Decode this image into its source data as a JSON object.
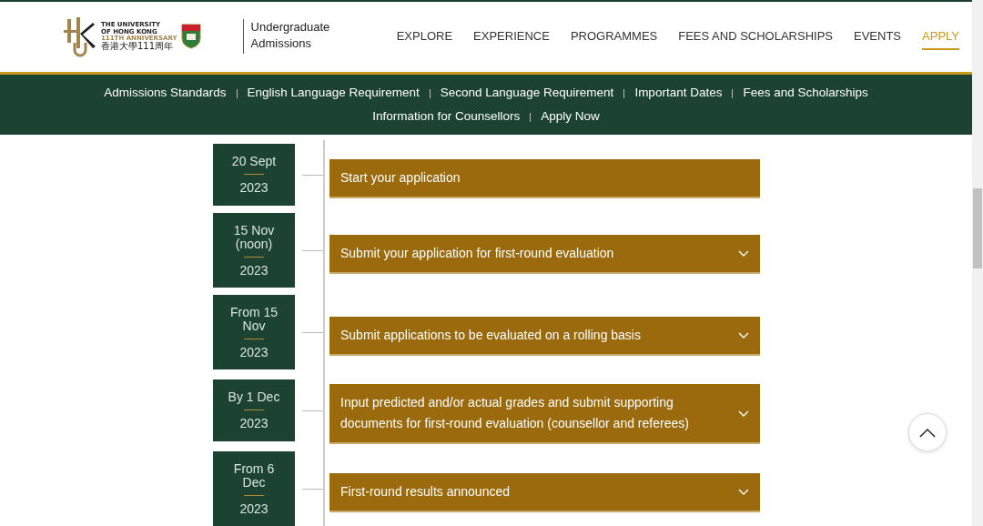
{
  "header": {
    "logo": {
      "lines": [
        "THE UNIVERSITY",
        "OF HONG KONG",
        "111TH ANNIVERSARY",
        "香港大學111周年"
      ]
    },
    "site_title": [
      "Undergraduate",
      "Admissions"
    ],
    "nav": [
      {
        "label": "EXPLORE",
        "selected": false
      },
      {
        "label": "EXPERIENCE",
        "selected": false
      },
      {
        "label": "PROGRAMMES",
        "selected": false
      },
      {
        "label": "FEES AND SCHOLARSHIPS",
        "selected": false
      },
      {
        "label": "EVENTS",
        "selected": false
      },
      {
        "label": "APPLY",
        "selected": true
      }
    ]
  },
  "subnav": [
    "Admissions Standards",
    "English Language Requirement",
    "Second Language Requirement",
    "Important Dates",
    "Fees and Scholarships",
    "Information for Counsellors",
    "Apply Now"
  ],
  "timeline": [
    {
      "date": "20 Sept",
      "year": "2023",
      "title": "Start your application",
      "expandable": false
    },
    {
      "date": "15 Nov (noon)",
      "year": "2023",
      "title": "Submit your application for first-round evaluation",
      "expandable": true
    },
    {
      "date": "From 15 Nov",
      "year": "2023",
      "title": "Submit applications to be evaluated on a rolling basis",
      "expandable": true
    },
    {
      "date": "By 1 Dec",
      "year": "2023",
      "title": "Input predicted and/or actual grades and submit supporting documents for first-round evaluation (counsellor and referees)",
      "expandable": true
    },
    {
      "date": "From 6 Dec",
      "year": "2023",
      "title": "First-round results announced",
      "expandable": true
    }
  ]
}
